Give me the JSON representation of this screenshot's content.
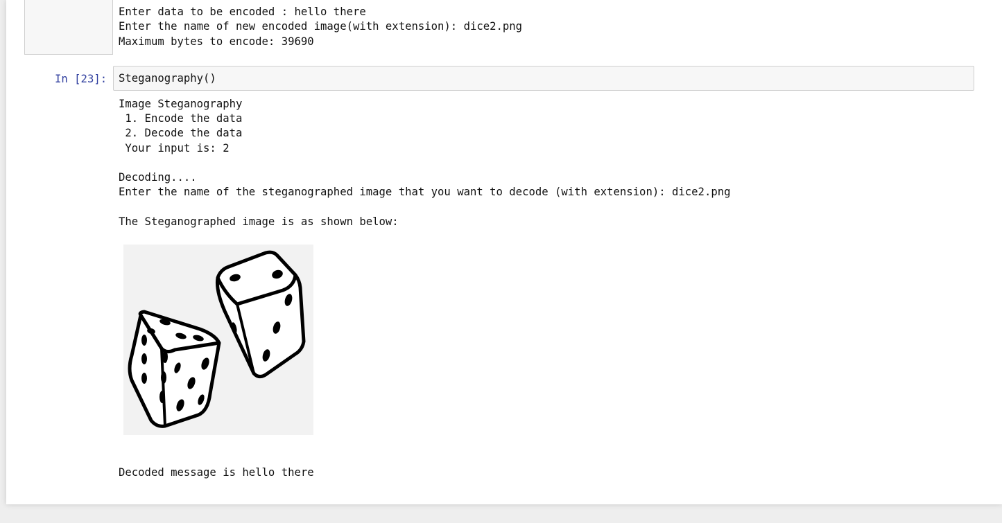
{
  "previous_output": {
    "lines": [
      "Enter data to be encoded : hello there",
      "Enter the name of new encoded image(with extension): dice2.png",
      "Maximum bytes to encode: 39690"
    ]
  },
  "cell": {
    "prompt": "In [23]:",
    "code": "Steganography()"
  },
  "output": {
    "lines": [
      "Image Steganography",
      " 1. Encode the data",
      " 2. Decode the data",
      " Your input is: 2",
      "",
      "Decoding....",
      "Enter the name of the steganographed image that you want to decode (with extension): dice2.png",
      "",
      "The Steganographed image is as shown below:"
    ],
    "image_alt": "dice-image",
    "decoded_message": "Decoded message is hello there"
  }
}
